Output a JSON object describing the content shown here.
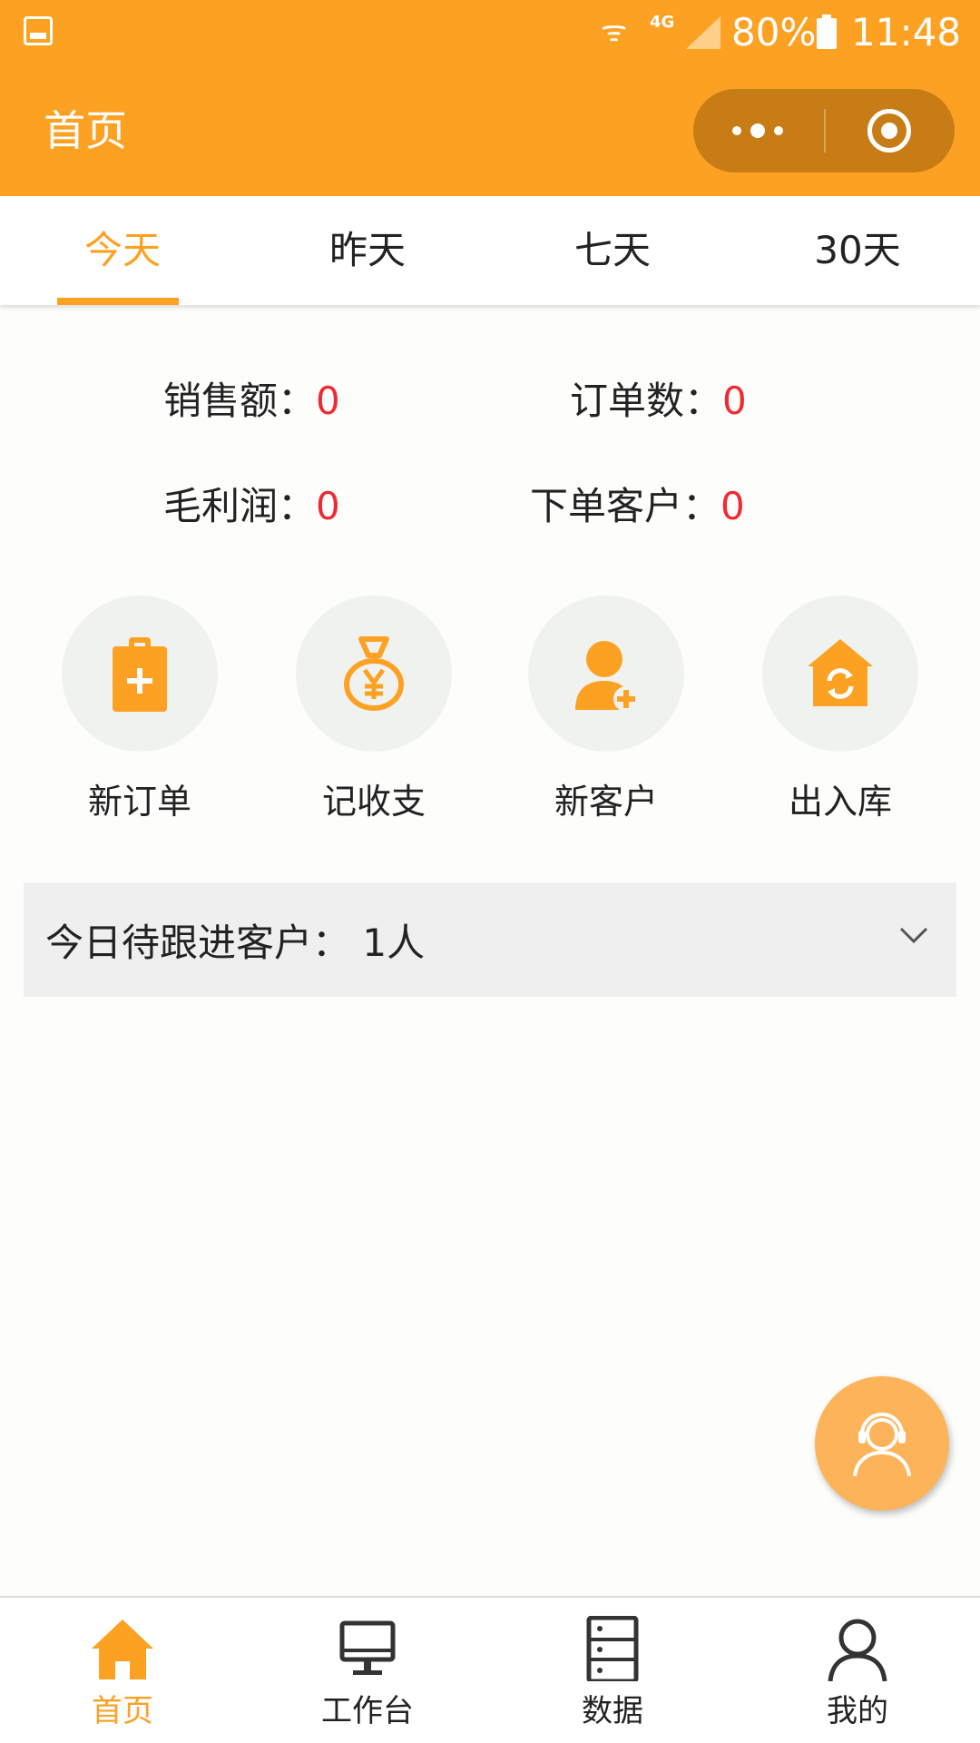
{
  "status_bar": {
    "network": "4G",
    "battery": "80%",
    "time": "11:48"
  },
  "nav": {
    "title": "首页"
  },
  "tabs": [
    {
      "label": "今天",
      "active": true
    },
    {
      "label": "昨天",
      "active": false
    },
    {
      "label": "七天",
      "active": false
    },
    {
      "label": "30天",
      "active": false
    }
  ],
  "stats": {
    "sales_label": "销售额：",
    "sales_value": "0",
    "orders_label": "订单数：",
    "orders_value": "0",
    "profit_label": "毛利润：",
    "profit_value": "0",
    "customers_label": "下单客户：",
    "customers_value": "0"
  },
  "actions": [
    {
      "label": "新订单",
      "icon": "clipboard-plus-icon"
    },
    {
      "label": "记收支",
      "icon": "money-bag-icon"
    },
    {
      "label": "新客户",
      "icon": "user-plus-icon"
    },
    {
      "label": "出入库",
      "icon": "warehouse-sync-icon"
    }
  ],
  "followup": {
    "text": "今日待跟进客户： 1人"
  },
  "tabbar": [
    {
      "label": "首页",
      "icon": "home-icon",
      "active": true
    },
    {
      "label": "工作台",
      "icon": "desktop-icon",
      "active": false
    },
    {
      "label": "数据",
      "icon": "server-icon",
      "active": false
    },
    {
      "label": "我的",
      "icon": "person-icon",
      "active": false
    }
  ],
  "colors": {
    "accent": "#fda123",
    "value_red": "#ee2a33",
    "capsule": "#c87c16"
  }
}
